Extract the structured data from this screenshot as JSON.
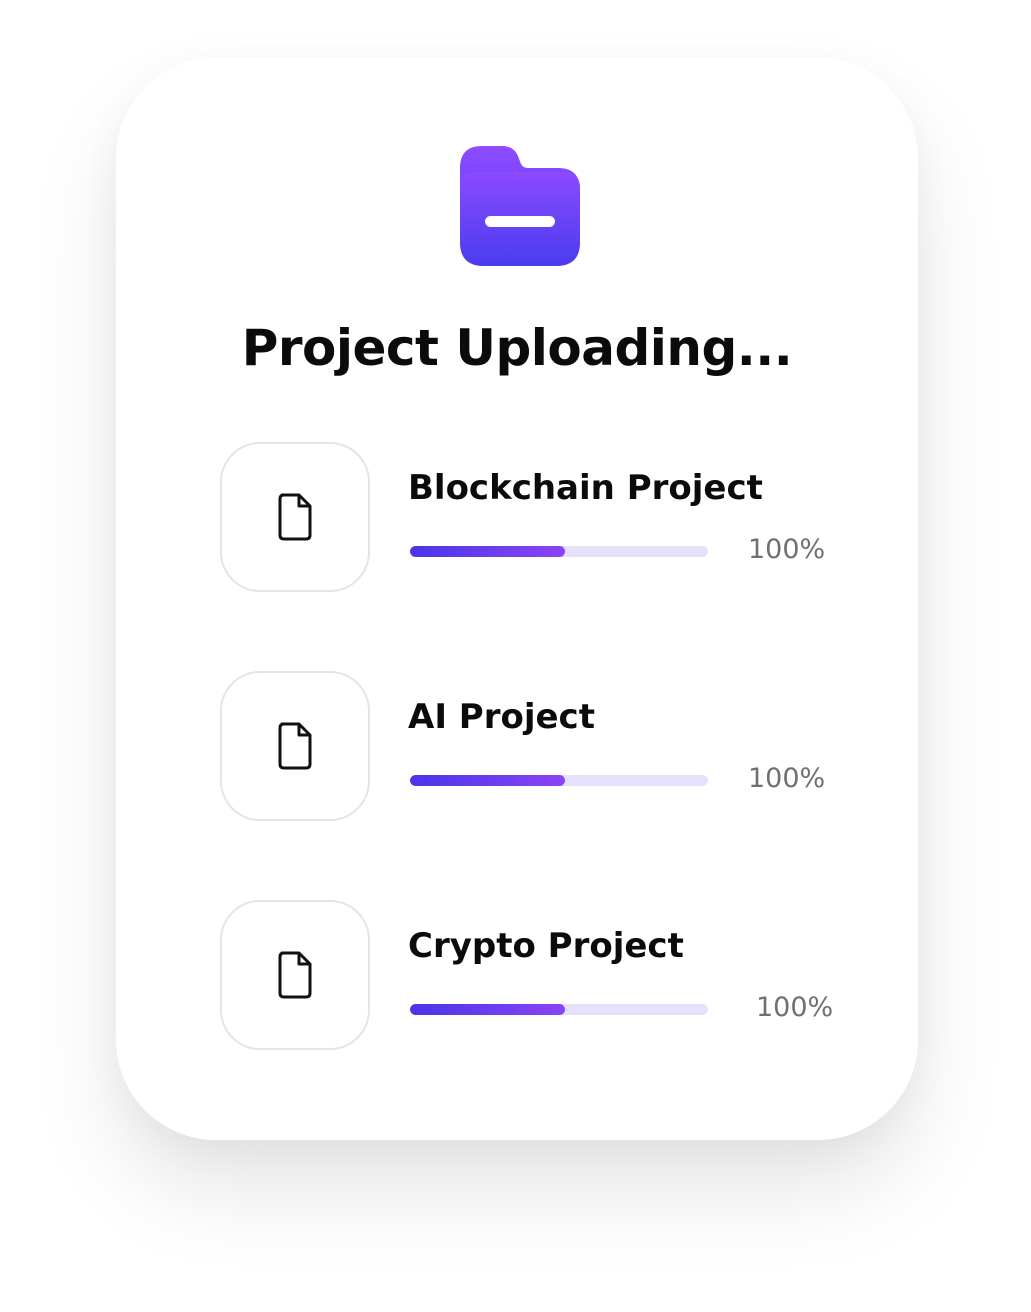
{
  "header": {
    "icon": "folder-minus-icon",
    "title": "Project Uploading..."
  },
  "projects": [
    {
      "name": "Blockchain Project",
      "progress_label": "100%",
      "bar_fill_fraction": 0.52,
      "icon": "file-icon"
    },
    {
      "name": "AI Project",
      "progress_label": "100%",
      "bar_fill_fraction": 0.52,
      "icon": "file-icon"
    },
    {
      "name": "Crypto Project",
      "progress_label": "100%",
      "bar_fill_fraction": 0.52,
      "icon": "file-icon"
    }
  ],
  "colors": {
    "accent_start": "#4a35e8",
    "accent_end": "#8a44f5",
    "track": "#e6e0fb",
    "folder_top": "#8f4bff",
    "folder_bottom": "#4a3cf0"
  }
}
